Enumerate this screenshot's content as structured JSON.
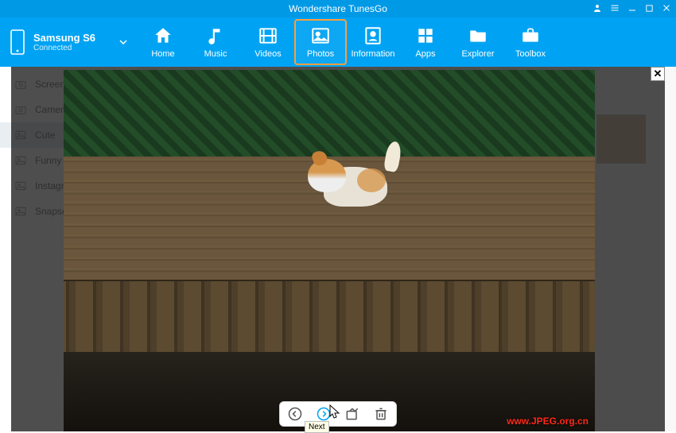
{
  "app": {
    "title": "Wondershare TunesGo"
  },
  "window_controls": {
    "user": "user",
    "minimize": "minimize",
    "maximize": "maximize",
    "close": "close"
  },
  "device": {
    "name": "Samsung S6",
    "status": "Connected",
    "icon": "phone-icon",
    "dropdown": "chevron-down-icon"
  },
  "nav": [
    {
      "key": "home",
      "label": "Home",
      "icon": "home-icon"
    },
    {
      "key": "music",
      "label": "Music",
      "icon": "music-icon"
    },
    {
      "key": "videos",
      "label": "Videos",
      "icon": "film-icon"
    },
    {
      "key": "photos",
      "label": "Photos",
      "icon": "picture-icon",
      "active": true
    },
    {
      "key": "information",
      "label": "Information",
      "icon": "contacts-icon"
    },
    {
      "key": "apps",
      "label": "Apps",
      "icon": "apps-icon"
    },
    {
      "key": "explorer",
      "label": "Explorer",
      "icon": "folder-icon"
    },
    {
      "key": "toolbox",
      "label": "Toolbox",
      "icon": "briefcase-icon"
    }
  ],
  "sidebar": {
    "items": [
      {
        "label": "Screenshots",
        "icon": "camera-icon"
      },
      {
        "label": "Camera",
        "icon": "camera-icon"
      },
      {
        "label": "Cute",
        "icon": "picture-icon",
        "selected": true
      },
      {
        "label": "Funny",
        "icon": "picture-icon"
      },
      {
        "label": "Instagram",
        "icon": "picture-icon"
      },
      {
        "label": "Snapseed",
        "icon": "picture-icon"
      }
    ]
  },
  "viewer": {
    "close": "✕",
    "toolbar": {
      "prev": "Previous",
      "next": "Next",
      "share": "Share",
      "delete": "Delete"
    },
    "tooltip": "Next",
    "watermark": "www.JPEG.org.cn"
  }
}
